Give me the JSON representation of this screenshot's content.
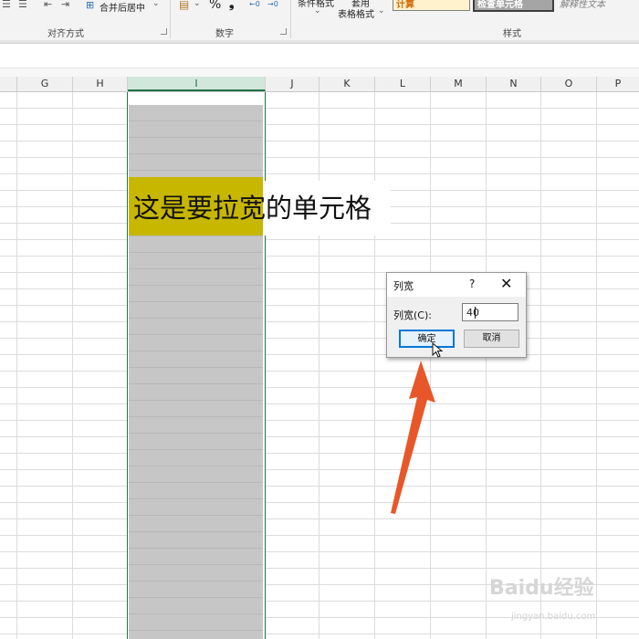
{
  "ribbon": {
    "alignment_group": {
      "merge_center_label": "合并后居中",
      "group_label": "对齐方式"
    },
    "number_group": {
      "percent_symbol": "%",
      "comma_symbol": "❟",
      "increase_decimal": "←0",
      "decrease_decimal": "→0",
      "group_label": "数字"
    },
    "styles_group": {
      "conditional_format_label": "条件格式",
      "table_format_label_top": "套用",
      "table_format_label": "表格格式",
      "style_calc": "计算",
      "style_check_cell": "检查单元格",
      "style_explanatory": "解释性文本",
      "group_label": "样式"
    }
  },
  "sheet": {
    "columns": [
      "G",
      "H",
      "I",
      "J",
      "K",
      "L",
      "M",
      "N",
      "O",
      "P"
    ],
    "selected_column": "I",
    "cell_text": "这是要拉宽的单元格",
    "cell_fill_color": "#c7b700",
    "selection_color": "#217346"
  },
  "dialog": {
    "title": "列宽",
    "help": "?",
    "close": "✕",
    "field_label": "列宽(C):",
    "field_value": "40",
    "ok_label": "确定",
    "cancel_label": "取消"
  },
  "annotation": {
    "arrow_color": "#e8572a"
  },
  "watermark": {
    "brand": "Baidu经验",
    "url": "jingyan.baidu.com"
  }
}
